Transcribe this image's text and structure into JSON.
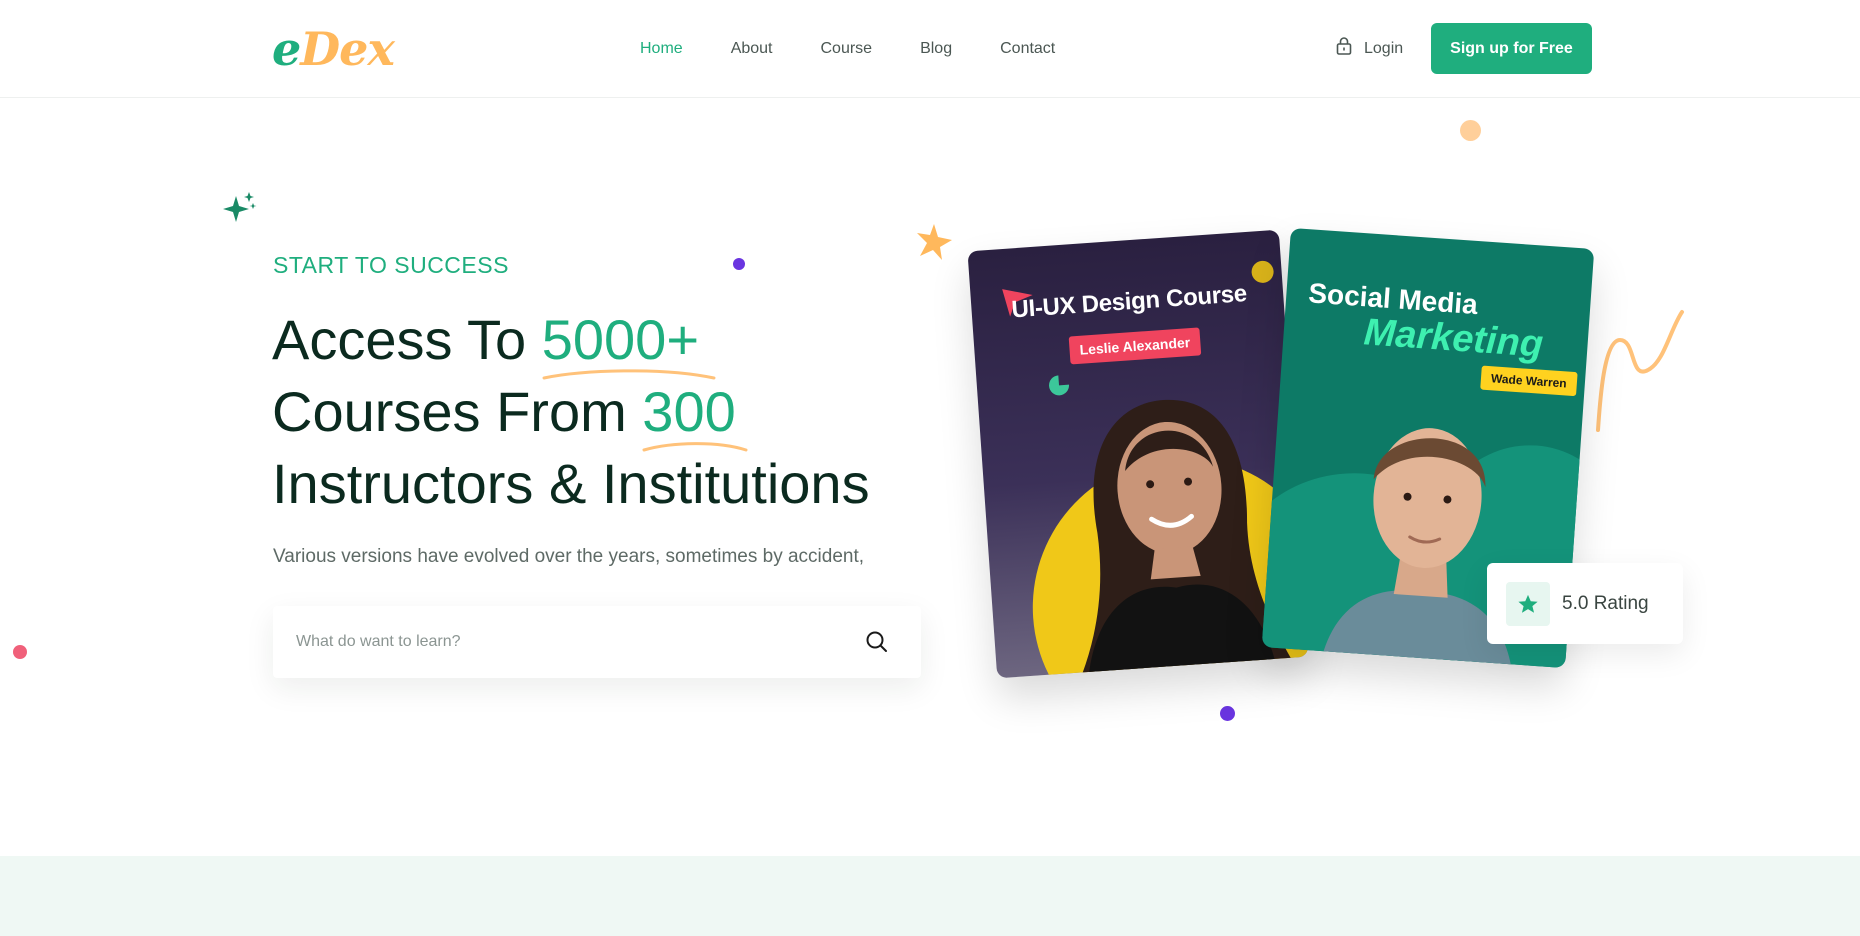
{
  "brand": {
    "logo_e": "e",
    "logo_dex": "Dex"
  },
  "nav": {
    "items": [
      {
        "label": "Home",
        "active": true
      },
      {
        "label": "About",
        "active": false
      },
      {
        "label": "Course",
        "active": false
      },
      {
        "label": "Blog",
        "active": false
      },
      {
        "label": "Contact",
        "active": false
      }
    ]
  },
  "header": {
    "login_label": "Login",
    "signup_label": "Sign up for Free"
  },
  "hero": {
    "eyebrow": "START TO SUCCESS",
    "line1_prefix": "Access To ",
    "line1_highlight": "5000+",
    "line2_prefix": "Courses From ",
    "line2_highlight": "300",
    "line3": "Instructors & Institutions",
    "subtext": "Various versions have evolved over the years, sometimes by accident,",
    "search_placeholder": "What do want to learn?"
  },
  "cards": {
    "card1": {
      "title": "UI-UX Design Course",
      "instructor": "Leslie Alexander"
    },
    "card2": {
      "title_line1": "Social Media",
      "title_line2": "Marketing",
      "instructor": "Wade Warren"
    }
  },
  "rating": {
    "label": "5.0 Rating"
  },
  "colors": {
    "brand_green": "#1fae7e",
    "brand_orange": "#ffb85c",
    "heading": "#0b2a1f",
    "accent_purple": "#6a35e0",
    "accent_pink": "#f0445e"
  }
}
